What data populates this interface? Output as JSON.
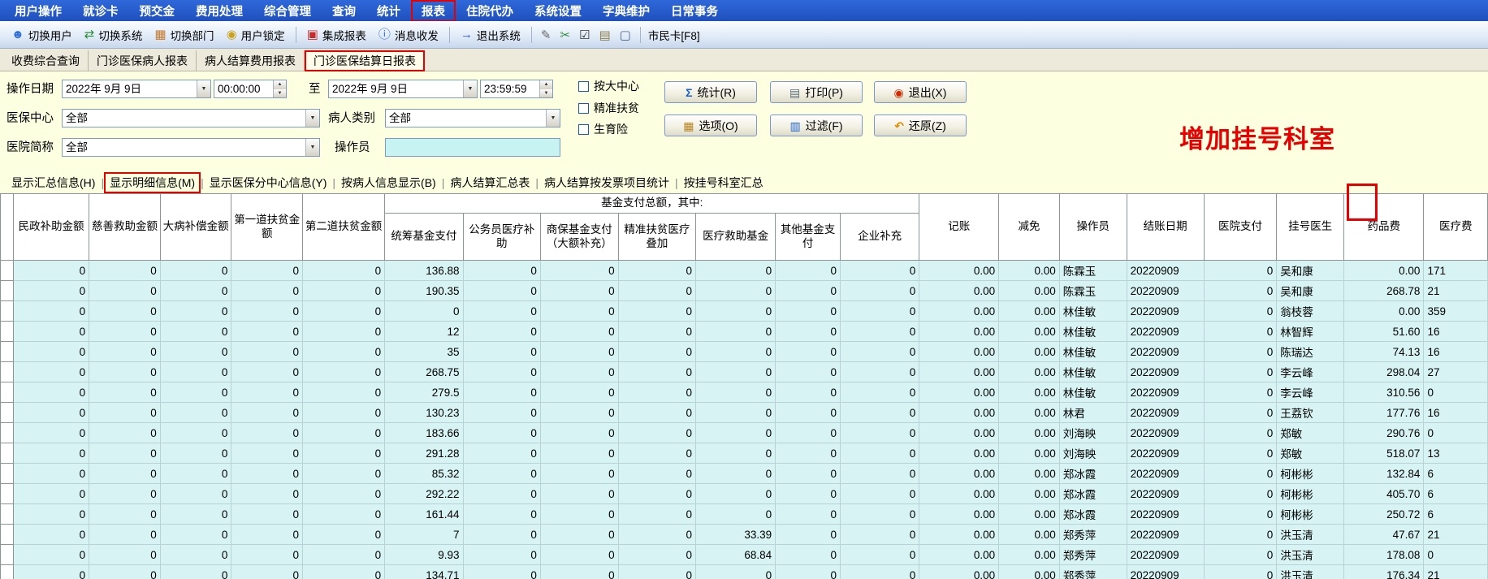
{
  "colors": {
    "annotation_red": "#e80000",
    "panel_yellow": "#fdffe1",
    "cell_cyan": "#d7f3f3",
    "operator_input_cyan": "#c7f3f3",
    "menu_blue": "#2a5fd0"
  },
  "annotations": {
    "boxed": [
      "报表",
      "门诊医保结算日报表",
      "显示明细信息(M)"
    ],
    "note": "增加挂号科室"
  },
  "menu_bar": {
    "items": [
      "用户操作",
      "就诊卡",
      "预交金",
      "费用处理",
      "综合管理",
      "查询",
      "统计",
      "报表",
      "住院代办",
      "系统设置",
      "字典维护",
      "日常事务"
    ]
  },
  "toolbar": {
    "buttons": [
      {
        "label": "切换用户",
        "icon": "switch-user"
      },
      {
        "label": "切换系统",
        "icon": "switch-system"
      },
      {
        "label": "切换部门",
        "icon": "switch-dept"
      },
      {
        "label": "用户锁定",
        "icon": "user-lock"
      },
      {
        "label": "集成报表",
        "icon": "integrated-report"
      },
      {
        "label": "消息收发",
        "icon": "messages"
      },
      {
        "label": "退出系统",
        "icon": "exit-system"
      }
    ],
    "quick_icons": [
      "edit",
      "tools",
      "check",
      "copy",
      "window"
    ],
    "citizen_card_label": "市民卡[F8]"
  },
  "tabs": {
    "items": [
      "收费综合查询",
      "门诊医保病人报表",
      "病人结算费用报表",
      "门诊医保结算日报表"
    ],
    "active": "门诊医保结算日报表"
  },
  "filters": {
    "date_label": "操作日期",
    "date_from": "2022年 9月 9日",
    "time_from": "00:00:00",
    "to_label": "至",
    "date_to": "2022年 9月 9日",
    "time_to": "23:59:59",
    "checkboxes": [
      "按大中心",
      "精准扶贫",
      "生育险"
    ],
    "center_label": "医保中心",
    "center_value": "全部",
    "patient_type_label": "病人类别",
    "patient_type_value": "全部",
    "hospital_label": "医院简称",
    "hospital_value": "全部",
    "operator_label": "操作员",
    "operator_value": "",
    "buttons_row1": [
      {
        "label": "统计(R)",
        "icon": "stat"
      },
      {
        "label": "打印(P)",
        "icon": "print"
      },
      {
        "label": "退出(X)",
        "icon": "exit"
      }
    ],
    "buttons_row2": [
      {
        "label": "选项(O)",
        "icon": "options"
      },
      {
        "label": "过滤(F)",
        "icon": "filter"
      },
      {
        "label": "还原(Z)",
        "icon": "restore"
      }
    ]
  },
  "subtabs": {
    "items": [
      "显示汇总信息(H)",
      "显示明细信息(M)",
      "显示医保分中心信息(Y)",
      "按病人信息显示(B)",
      "病人结算汇总表",
      "病人结算按发票项目统计",
      "按挂号科室汇总"
    ],
    "active": "显示明细信息(M)"
  },
  "table": {
    "left_columns": [
      "民政补助金额",
      "慈善救助金额",
      "大病补偿金额",
      "第一道扶贫金额",
      "第二道扶贫金额"
    ],
    "fund_group_label": "基金支付总额，其中:",
    "fund_columns": [
      "统筹基金支付",
      "公务员医疗补助",
      "商保基金支付（大额补充）",
      "精准扶贫医疗叠加",
      "医疗救助基金",
      "其他基金支付",
      "企业补充"
    ],
    "right_columns": [
      "记账",
      "减免",
      "操作员",
      "结账日期",
      "医院支付",
      "挂号医生",
      "药品费",
      "医疗费"
    ],
    "rows": [
      [
        "0",
        "0",
        "0",
        "0",
        "0",
        "136.88",
        "0",
        "0",
        "0",
        "0",
        "0",
        "0",
        "0.00",
        "0.00",
        "陈霖玉",
        "20220909",
        "0",
        "吴和康",
        "0.00",
        "171"
      ],
      [
        "0",
        "0",
        "0",
        "0",
        "0",
        "190.35",
        "0",
        "0",
        "0",
        "0",
        "0",
        "0",
        "0.00",
        "0.00",
        "陈霖玉",
        "20220909",
        "0",
        "吴和康",
        "268.78",
        "21"
      ],
      [
        "0",
        "0",
        "0",
        "0",
        "0",
        "0",
        "0",
        "0",
        "0",
        "0",
        "0",
        "0",
        "0.00",
        "0.00",
        "林佳敏",
        "20220909",
        "0",
        "翁枝蓉",
        "0.00",
        "359"
      ],
      [
        "0",
        "0",
        "0",
        "0",
        "0",
        "12",
        "0",
        "0",
        "0",
        "0",
        "0",
        "0",
        "0.00",
        "0.00",
        "林佳敏",
        "20220909",
        "0",
        "林智辉",
        "51.60",
        "16"
      ],
      [
        "0",
        "0",
        "0",
        "0",
        "0",
        "35",
        "0",
        "0",
        "0",
        "0",
        "0",
        "0",
        "0.00",
        "0.00",
        "林佳敏",
        "20220909",
        "0",
        "陈瑞达",
        "74.13",
        "16"
      ],
      [
        "0",
        "0",
        "0",
        "0",
        "0",
        "268.75",
        "0",
        "0",
        "0",
        "0",
        "0",
        "0",
        "0.00",
        "0.00",
        "林佳敏",
        "20220909",
        "0",
        "李云峰",
        "298.04",
        "27"
      ],
      [
        "0",
        "0",
        "0",
        "0",
        "0",
        "279.5",
        "0",
        "0",
        "0",
        "0",
        "0",
        "0",
        "0.00",
        "0.00",
        "林佳敏",
        "20220909",
        "0",
        "李云峰",
        "310.56",
        "0"
      ],
      [
        "0",
        "0",
        "0",
        "0",
        "0",
        "130.23",
        "0",
        "0",
        "0",
        "0",
        "0",
        "0",
        "0.00",
        "0.00",
        "林君",
        "20220909",
        "0",
        "王荔钦",
        "177.76",
        "16"
      ],
      [
        "0",
        "0",
        "0",
        "0",
        "0",
        "183.66",
        "0",
        "0",
        "0",
        "0",
        "0",
        "0",
        "0.00",
        "0.00",
        "刘海映",
        "20220909",
        "0",
        "郑敏",
        "290.76",
        "0"
      ],
      [
        "0",
        "0",
        "0",
        "0",
        "0",
        "291.28",
        "0",
        "0",
        "0",
        "0",
        "0",
        "0",
        "0.00",
        "0.00",
        "刘海映",
        "20220909",
        "0",
        "郑敏",
        "518.07",
        "13"
      ],
      [
        "0",
        "0",
        "0",
        "0",
        "0",
        "85.32",
        "0",
        "0",
        "0",
        "0",
        "0",
        "0",
        "0.00",
        "0.00",
        "郑冰霞",
        "20220909",
        "0",
        "柯彬彬",
        "132.84",
        "6"
      ],
      [
        "0",
        "0",
        "0",
        "0",
        "0",
        "292.22",
        "0",
        "0",
        "0",
        "0",
        "0",
        "0",
        "0.00",
        "0.00",
        "郑冰霞",
        "20220909",
        "0",
        "柯彬彬",
        "405.70",
        "6"
      ],
      [
        "0",
        "0",
        "0",
        "0",
        "0",
        "161.44",
        "0",
        "0",
        "0",
        "0",
        "0",
        "0",
        "0.00",
        "0.00",
        "郑冰霞",
        "20220909",
        "0",
        "柯彬彬",
        "250.72",
        "6"
      ],
      [
        "0",
        "0",
        "0",
        "0",
        "0",
        "7",
        "0",
        "0",
        "0",
        "33.39",
        "0",
        "0",
        "0.00",
        "0.00",
        "郑秀萍",
        "20220909",
        "0",
        "洪玉清",
        "47.67",
        "21"
      ],
      [
        "0",
        "0",
        "0",
        "0",
        "0",
        "9.93",
        "0",
        "0",
        "0",
        "68.84",
        "0",
        "0",
        "0.00",
        "0.00",
        "郑秀萍",
        "20220909",
        "0",
        "洪玉清",
        "178.08",
        "0"
      ],
      [
        "0",
        "0",
        "0",
        "0",
        "0",
        "134.71",
        "0",
        "0",
        "0",
        "0",
        "0",
        "0",
        "0.00",
        "0.00",
        "郑秀萍",
        "20220909",
        "0",
        "洪玉清",
        "176.34",
        "21"
      ]
    ]
  }
}
